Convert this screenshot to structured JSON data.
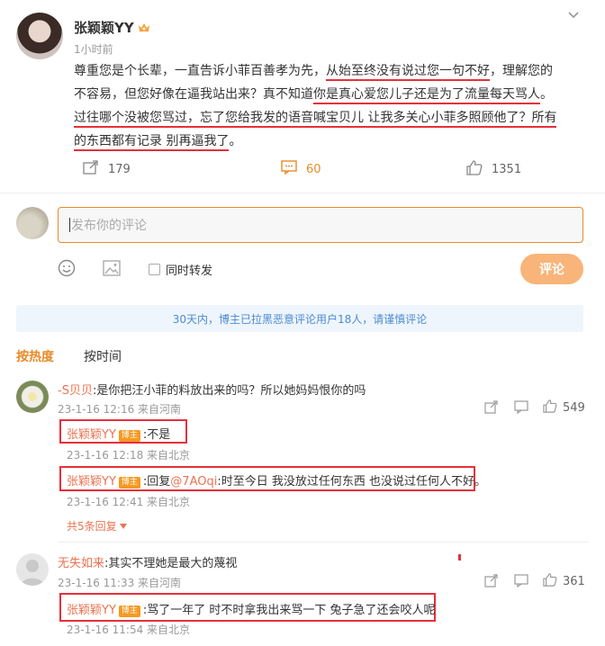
{
  "post": {
    "author": "张颖颖YY",
    "time": "1小时前",
    "lines": [
      {
        "a": "尊重您是个长辈，一直告诉小菲百善孝为先，",
        "u": "从始至终没有说过您一句不好",
        "b": "，理解您的"
      },
      {
        "a": "不容易，但您好像在逼我站出来？真不知道",
        "u": "你是真心爱您儿子还是为了流量每天骂人",
        "b": "。"
      },
      {
        "a": "",
        "u": "过往哪个没被您骂过，忘了您给我发的语音喊宝贝儿 让我多关心小菲多照顾他了？所有",
        "b": ""
      },
      {
        "a": "",
        "u": "的东西都有记录 别再逼我了",
        "b": "。"
      }
    ],
    "reposts": "179",
    "comments": "60",
    "likes": "1351"
  },
  "composer": {
    "placeholder": "发布你的评论",
    "also_repost": "同时转发",
    "submit": "评论"
  },
  "notice": "30天内，博主已拉黑恶意评论用户18人，请谨慎评论",
  "sort": {
    "hot": "按热度",
    "time": "按时间"
  },
  "comments": [
    {
      "name": "-S贝贝",
      "text": ":是你把汪小菲的料放出来的吗？所以她妈妈恨你的吗",
      "meta": "23-1-16 12:16 来自河南",
      "likes": "549",
      "replies": [
        {
          "name": "张颖颖YY",
          "badge": "博主",
          "text": ":不是",
          "meta": "23-1-16 12:18 来自北京"
        },
        {
          "name": "张颖颖YY",
          "badge": "博主",
          "pre": ":回复",
          "mention": "@7AOqi",
          "text": ":时至今日 我没放过任何东西 也没说过任何人不好。",
          "meta": "23-1-16 12:41 来自北京"
        }
      ],
      "more": "共5条回复"
    },
    {
      "name": "无失如来",
      "text": ":其实不理她是最大的蔑视",
      "meta": "23-1-16 11:33 来自河南",
      "likes": "361",
      "replies": [
        {
          "name": "张颖颖YY",
          "badge": "博主",
          "text": ":骂了一年了 时不时拿我出来骂一下 兔子急了还会咬人呢",
          "meta": "23-1-16 11:54 来自北京"
        }
      ]
    }
  ]
}
